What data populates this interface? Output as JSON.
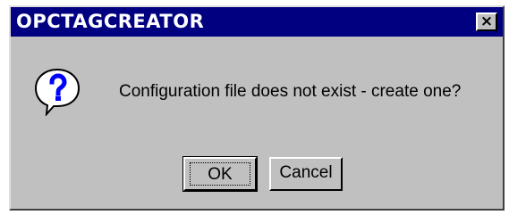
{
  "window": {
    "title": "OPCTAGCREATOR",
    "close_label": "×"
  },
  "content": {
    "icon": "question-icon",
    "message": "Configuration file does not exist - create one?"
  },
  "buttons": {
    "ok_label": "OK",
    "cancel_label": "Cancel"
  },
  "colors": {
    "titlebar": "#000080",
    "face": "#c0c0c0",
    "icon_accent": "#0000ff"
  }
}
